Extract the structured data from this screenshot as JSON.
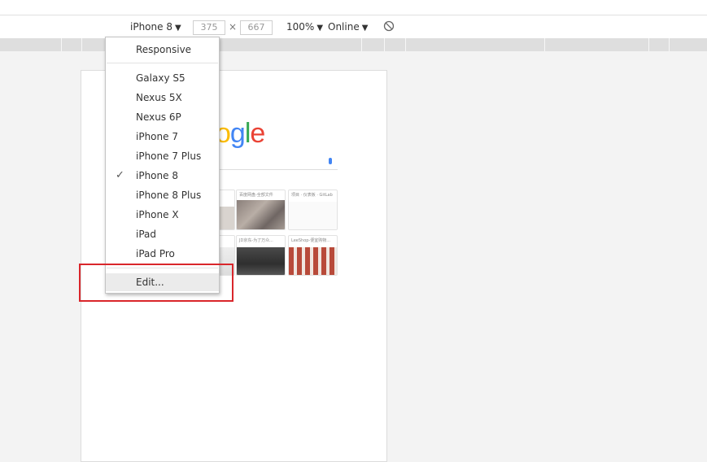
{
  "toolbar": {
    "device": "iPhone 8",
    "width": "375",
    "times": "×",
    "height": "667",
    "zoom": "100%",
    "network": "Online",
    "caret": "▼"
  },
  "menu": {
    "responsive": "Responsive",
    "devices": [
      {
        "label": "Galaxy S5",
        "checked": false
      },
      {
        "label": "Nexus 5X",
        "checked": false
      },
      {
        "label": "Nexus 6P",
        "checked": false
      },
      {
        "label": "iPhone 7",
        "checked": false
      },
      {
        "label": "iPhone 7 Plus",
        "checked": false
      },
      {
        "label": "iPhone 8",
        "checked": true
      },
      {
        "label": "iPhone 8 Plus",
        "checked": false
      },
      {
        "label": "iPhone X",
        "checked": false
      },
      {
        "label": "iPad",
        "checked": false
      },
      {
        "label": "iPad Pro",
        "checked": false
      }
    ],
    "checkmark": "✓",
    "edit": "Edit..."
  },
  "page": {
    "logo_visible": "ogle",
    "tiles": [
      {
        "caption": ""
      },
      {
        "caption": "百度网盘-全部文件"
      },
      {
        "caption": "项目 · 仪表板 · GitLab"
      },
      {
        "caption": ""
      },
      {
        "caption": "JD京东-为了万众..."
      },
      {
        "caption": "LeeShop-便宜购物..."
      }
    ]
  },
  "colors": {
    "annotation_box": "#d9262b",
    "logo_blue": "#4285f4",
    "logo_red": "#ea4335",
    "logo_yellow": "#fbbc05",
    "logo_green": "#34a853"
  }
}
